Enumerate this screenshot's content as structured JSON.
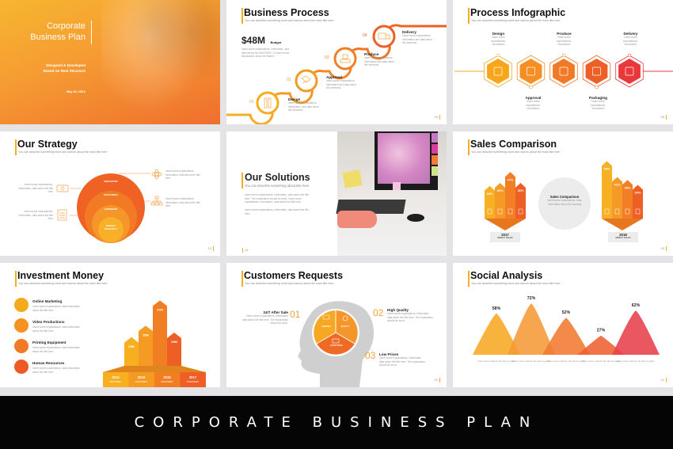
{
  "cover": {
    "title_line1": "Corporate",
    "title_line2": "Business Plan",
    "subtitle_line1": "Designed & Developed",
    "subtitle_line2": "Based on Real Structure",
    "date": "May 25, 20XX"
  },
  "business_process": {
    "title": "Business Process",
    "subtitle": "You can describe something short and narrow about the main title here",
    "budget_value": "$48M",
    "budget_label": "Budget",
    "budget_desc": "Insert some explanations, information, and dimensions the ANOTHER. Or insert some explanation about the Rather.",
    "steps": [
      {
        "num": "01",
        "label": "Design",
        "desc": "Insert some explanations, information, and data about the Elements",
        "icon": "ruler-pencil-icon"
      },
      {
        "num": "02",
        "label": "Approval",
        "desc": "Insert some explanations, information and data about the elements",
        "icon": "handshake-icon"
      },
      {
        "num": "03",
        "label": "Produce",
        "desc": "Insert some explanations, information and data about the elements",
        "icon": "conveyor-box-icon"
      },
      {
        "num": "04",
        "label": "Delivery",
        "desc": "Insert some explanations, information and data about the elements",
        "icon": "truck-icon"
      }
    ],
    "page": "03"
  },
  "process_infographic": {
    "title": "Process Infographic",
    "subtitle": "You can describe something short and narrow about the main title here",
    "steps": [
      {
        "label": "Design",
        "desc": "Insert some explanations, information",
        "color": "#f7a61c",
        "icon": "ruler-pencil-icon",
        "pos": "top"
      },
      {
        "label": "Approval",
        "desc": "Insert some explanations, information",
        "color": "#f58f23",
        "icon": "handshake-icon",
        "pos": "bottom"
      },
      {
        "label": "Produce",
        "desc": "Insert some explanations, information",
        "color": "#f27a26",
        "icon": "conveyor-box-icon",
        "pos": "top"
      },
      {
        "label": "Packaging",
        "desc": "Insert some explanations, information",
        "color": "#ee5f28",
        "icon": "hand-truck-icon",
        "pos": "bottom"
      },
      {
        "label": "Delivery",
        "desc": "Insert some explanations, information",
        "color": "#e8383c",
        "icon": "truck-icon",
        "pos": "top"
      }
    ],
    "page": "05"
  },
  "strategy": {
    "title": "Our Strategy",
    "subtitle": "You can describe something short and narrow about the main title here",
    "rings": [
      "INNOVATION",
      "INVESTMENT",
      "EXPANSION",
      "MARKET RESEARCH"
    ],
    "callouts": [
      {
        "side": "left",
        "icon": "money-icon",
        "text": "Insert some explanations, information, data about the title here"
      },
      {
        "side": "left",
        "icon": "calculator-icon",
        "text": "Insert some explanations, information, data about the title here"
      },
      {
        "side": "right",
        "icon": "atom-icon",
        "text": "Insert some explanations, information, data about the title here"
      },
      {
        "side": "right",
        "icon": "org-chart-icon",
        "text": "Insert some explanations, information, data about the title here"
      }
    ],
    "page": "10"
  },
  "solutions": {
    "title": "Our Solutions",
    "subtitle": "You can describe something about title here",
    "para1": "Insert some explanations, information, data about the title here. The explanation should be short. Insert some explanations, information, data about the title here.",
    "para2": "Insert some explanations, information, data about the title here.",
    "page": "13"
  },
  "sales_comparison": {
    "title": "Sales Comparison",
    "subtitle": "You can describe something short and narrow about the main title here",
    "center_title": "Sales Comparison",
    "center_text": "Insert some explanations, data, information about the warning",
    "groups": [
      {
        "year": "2017",
        "caption": "DIRECT SALES",
        "values": [
          "33%",
          "36%",
          "47%",
          "36%"
        ]
      },
      {
        "year": "2018",
        "caption": "DIRECT SALES",
        "values": [
          "58%",
          "42%",
          "39%",
          "34%"
        ]
      }
    ],
    "device_icons": [
      "phone-icon",
      "tablet-icon",
      "laptop-icon",
      "monitor-icon"
    ],
    "page": "15"
  },
  "investment": {
    "title": "Investment Money",
    "subtitle": "You can describe something short and narrow about the main title here",
    "items": [
      {
        "label": "Online Marketing",
        "desc": "Insert some explanations, data information about the title here",
        "icon": "megaphone-icon",
        "color": "#f5a91c"
      },
      {
        "label": "Video Productions",
        "desc": "Insert some explanations, data information about the title here",
        "icon": "video-camera-icon",
        "color": "#f59222"
      },
      {
        "label": "Printing Equipment",
        "desc": "Insert some explanations, data information about the title here",
        "icon": "printer-icon",
        "color": "#f27a26"
      },
      {
        "label": "Human Resources",
        "desc": "Insert some explanations, data information about the title here",
        "icon": "people-icon",
        "color": "#ee5a25"
      }
    ],
    "bars": [
      {
        "value": "25M",
        "year": "2014",
        "caption": "INVESTMENT"
      },
      {
        "value": "35M",
        "year": "2015",
        "caption": "INVESTMENT"
      },
      {
        "value": "57M",
        "year": "2016",
        "caption": "INVESTMENT"
      },
      {
        "value": "29M",
        "year": "2017",
        "caption": "INVESTMENT"
      }
    ]
  },
  "customers": {
    "title": "Customers Requests",
    "subtitle": "You can describe something short and narrow about the main title here",
    "items": [
      {
        "num": "01",
        "label": "24/7 After Sale",
        "desc": "Insert some explanations, information data about the title here. The explanation should be short."
      },
      {
        "num": "02",
        "label": "High Quality",
        "desc": "Insert some explanations, information data about the title here. The explanation should be short."
      },
      {
        "num": "03",
        "label": "Low Prices",
        "desc": "Insert some explanations, information data about the title here. The explanation should be short."
      }
    ],
    "pie_labels": [
      "SUPPORT",
      "QUALITY",
      "GOOD PRICE"
    ],
    "page": "20"
  },
  "social": {
    "title": "Social Analysis",
    "subtitle": "You can describe something short and narrow about the main title here",
    "peaks": [
      {
        "value": "58%",
        "desc": "Insert some data & info about graph",
        "color": "#f7a823"
      },
      {
        "value": "72%",
        "desc": "Insert some data & info about graph",
        "color": "#f59a35"
      },
      {
        "value": "52%",
        "desc": "Insert some data & info about graph",
        "color": "#f27a30"
      },
      {
        "value": "27%",
        "desc": "Insert some data & info about graph",
        "color": "#ee6030"
      },
      {
        "value": "62%",
        "desc": "Insert some data & info about graph",
        "color": "#e8404a"
      }
    ],
    "page": "22"
  },
  "banner": {
    "text": "CORPORATE BUSINESS PLAN"
  },
  "chart_data": [
    {
      "type": "bar",
      "title": "Sales Comparison 2017",
      "categories": [
        "Phone",
        "Tablet",
        "Laptop",
        "Monitor"
      ],
      "values": [
        33,
        36,
        47,
        36
      ],
      "ylabel": "%"
    },
    {
      "type": "bar",
      "title": "Sales Comparison 2018",
      "categories": [
        "Phone",
        "Tablet",
        "Laptop",
        "Monitor"
      ],
      "values": [
        58,
        42,
        39,
        34
      ],
      "ylabel": "%"
    },
    {
      "type": "bar",
      "title": "Investment Money",
      "categories": [
        "2014",
        "2015",
        "2016",
        "2017"
      ],
      "values": [
        25,
        35,
        57,
        29
      ],
      "ylabel": "M"
    },
    {
      "type": "area",
      "title": "Social Analysis",
      "categories": [
        "1",
        "2",
        "3",
        "4",
        "5"
      ],
      "values": [
        58,
        72,
        52,
        27,
        62
      ],
      "ylabel": "%"
    }
  ]
}
